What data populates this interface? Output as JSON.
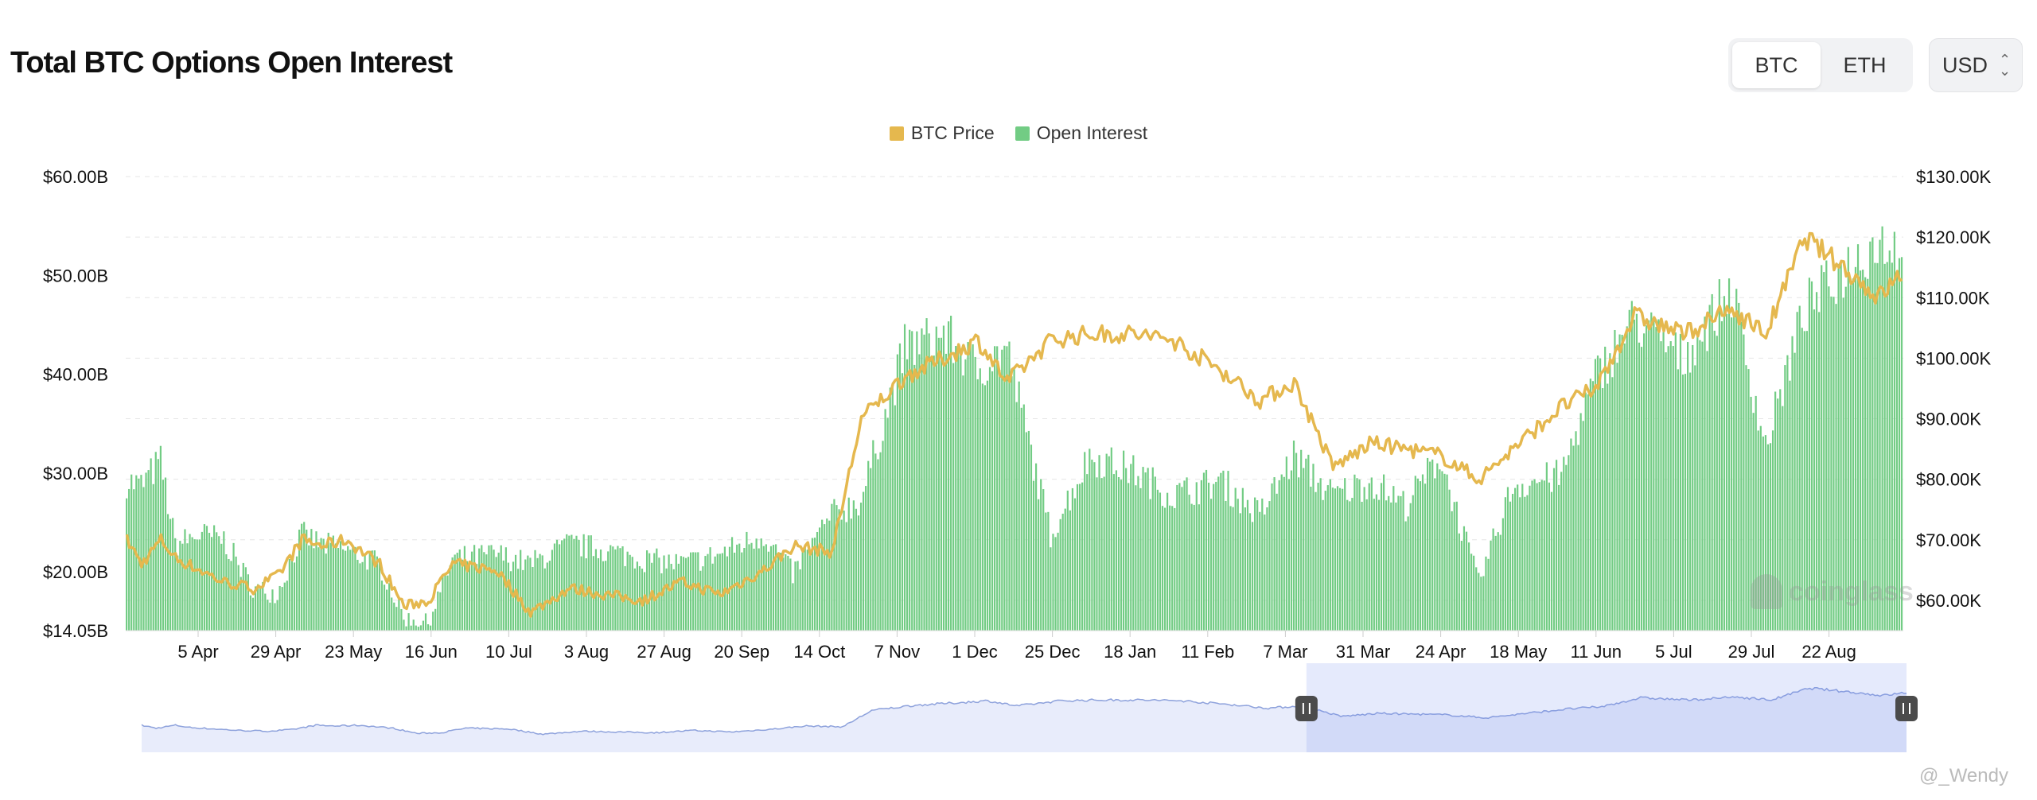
{
  "header": {
    "title": "Total BTC Options Open Interest"
  },
  "asset_toggle": {
    "options": [
      "BTC",
      "ETH"
    ],
    "selected": "BTC"
  },
  "currency": {
    "label": "USD"
  },
  "legend": [
    {
      "name": "BTC Price",
      "color": "#e5b84e"
    },
    {
      "name": "Open Interest",
      "color": "#72cc84"
    }
  ],
  "watermark": "coinglass",
  "credit": "@_Wendy",
  "chart_data": {
    "type": "bar",
    "series": [
      {
        "name": "Open Interest",
        "type": "bar",
        "axis": "left",
        "color": "#72cc84",
        "x_index": [
          0,
          6,
          14,
          20,
          30,
          40,
          52,
          62,
          72,
          80,
          90,
          104,
          114,
          124,
          134,
          152,
          166,
          182,
          196,
          212,
          228,
          244,
          262,
          274,
          290,
          302,
          320,
          336,
          350,
          362,
          380,
          396,
          414,
          430,
          450,
          466,
          480,
          496,
          512,
          526,
          540,
          556,
          570,
          590,
          604,
          620,
          640,
          660,
          674,
          690,
          706,
          720,
          730
        ],
        "values": [
          29.5,
          29,
          31.5,
          23,
          24,
          23.5,
          18.5,
          18,
          24,
          23,
          22.5,
          21,
          15.5,
          15,
          21.5,
          22,
          21,
          23,
          22.5,
          21.5,
          21,
          22,
          24,
          20,
          26,
          27.5,
          43,
          44.5,
          41,
          43,
          24,
          32,
          30.5,
          28,
          29.5,
          26,
          32,
          28,
          29.5,
          27,
          32,
          19,
          29,
          30,
          40,
          46,
          42,
          49,
          33,
          47,
          51,
          54,
          53.5
        ]
      },
      {
        "name": "BTC Price",
        "type": "line",
        "axis": "right",
        "color": "#e5b84e",
        "x_index": [
          0,
          6,
          14,
          20,
          30,
          40,
          52,
          62,
          72,
          80,
          90,
          104,
          114,
          124,
          134,
          152,
          166,
          182,
          196,
          212,
          228,
          244,
          262,
          274,
          290,
          302,
          320,
          336,
          350,
          362,
          380,
          396,
          414,
          430,
          450,
          466,
          480,
          496,
          512,
          526,
          540,
          556,
          570,
          590,
          604,
          620,
          640,
          660,
          674,
          690,
          706,
          720,
          730
        ],
        "values": [
          70,
          66,
          70,
          67,
          65,
          63,
          62,
          64,
          70,
          69,
          70,
          66,
          59,
          60,
          66,
          65,
          58,
          62,
          61,
          60,
          63,
          61,
          65,
          69,
          68,
          90,
          97,
          100,
          103,
          96,
          103,
          104,
          104,
          103,
          98,
          93,
          96,
          82,
          86,
          85,
          84,
          80,
          85,
          92,
          95,
          107,
          104,
          108,
          104,
          120,
          115,
          110,
          114
        ]
      }
    ],
    "categories": [
      "5 Apr",
      "29 Apr",
      "23 May",
      "16 Jun",
      "10 Jul",
      "3 Aug",
      "27 Aug",
      "20 Sep",
      "14 Oct",
      "7 Nov",
      "1 Dec",
      "25 Dec",
      "18 Jan",
      "11 Feb",
      "7 Mar",
      "31 Mar",
      "24 Apr",
      "18 May",
      "11 Jun",
      "5 Jul",
      "29 Jul",
      "22 Aug"
    ],
    "y_left": {
      "ticks": [
        "$14.05B",
        "$20.00B",
        "$30.00B",
        "$40.00B",
        "$50.00B",
        "$60.00B"
      ],
      "range": [
        14.05,
        60
      ]
    },
    "y_right": {
      "ticks": [
        "$60.00K",
        "$70.00K",
        "$80.00K",
        "$90.00K",
        "$100.00K",
        "$110.00K",
        "$120.00K",
        "$130.00K"
      ],
      "range": [
        55,
        130
      ]
    },
    "grid": true,
    "legend_position": "top-center",
    "navigator": {
      "selected_start_fraction": 0.66,
      "selected_end_fraction": 1.0
    }
  }
}
